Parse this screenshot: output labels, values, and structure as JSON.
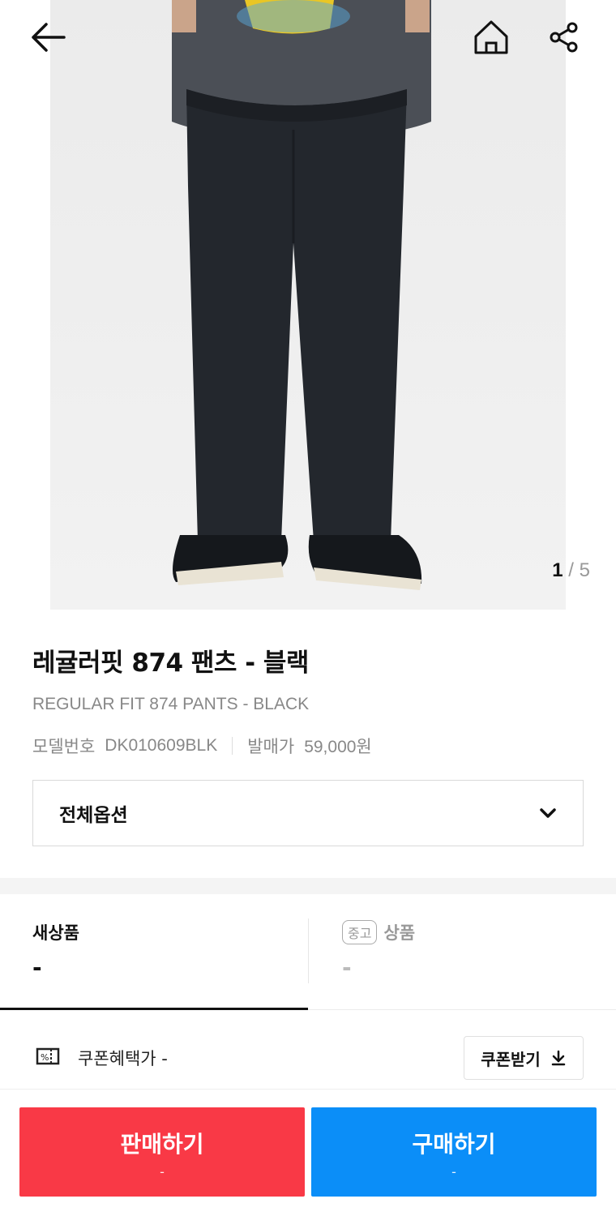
{
  "gallery": {
    "current": "1",
    "separator": "/",
    "total": "5"
  },
  "topbar": {
    "back_icon": "arrow-left-icon",
    "home_icon": "home-icon",
    "share_icon": "share-icon"
  },
  "product": {
    "title_ko": "레귤러핏 874 팬츠 - 블랙",
    "title_en": "REGULAR FIT 874 PANTS - BLACK",
    "model_label": "모델번호",
    "model_value": "DK010609BLK",
    "release_label": "발매가",
    "release_value": "59,000원"
  },
  "options": {
    "label": "전체옵션",
    "icon": "chevron-down-icon"
  },
  "tabs": {
    "new": {
      "title": "새상품",
      "price": "-"
    },
    "used": {
      "badge": "중고",
      "title": "상품",
      "price": "-"
    }
  },
  "coupon": {
    "icon": "coupon-icon",
    "text": "쿠폰혜택가 -",
    "button_label": "쿠폰받기",
    "button_icon": "download-icon"
  },
  "cta": {
    "sell": {
      "label": "판매하기",
      "sub": "-",
      "color": "#f93946"
    },
    "buy": {
      "label": "구매하기",
      "sub": "-",
      "color": "#0b8ef8"
    }
  }
}
